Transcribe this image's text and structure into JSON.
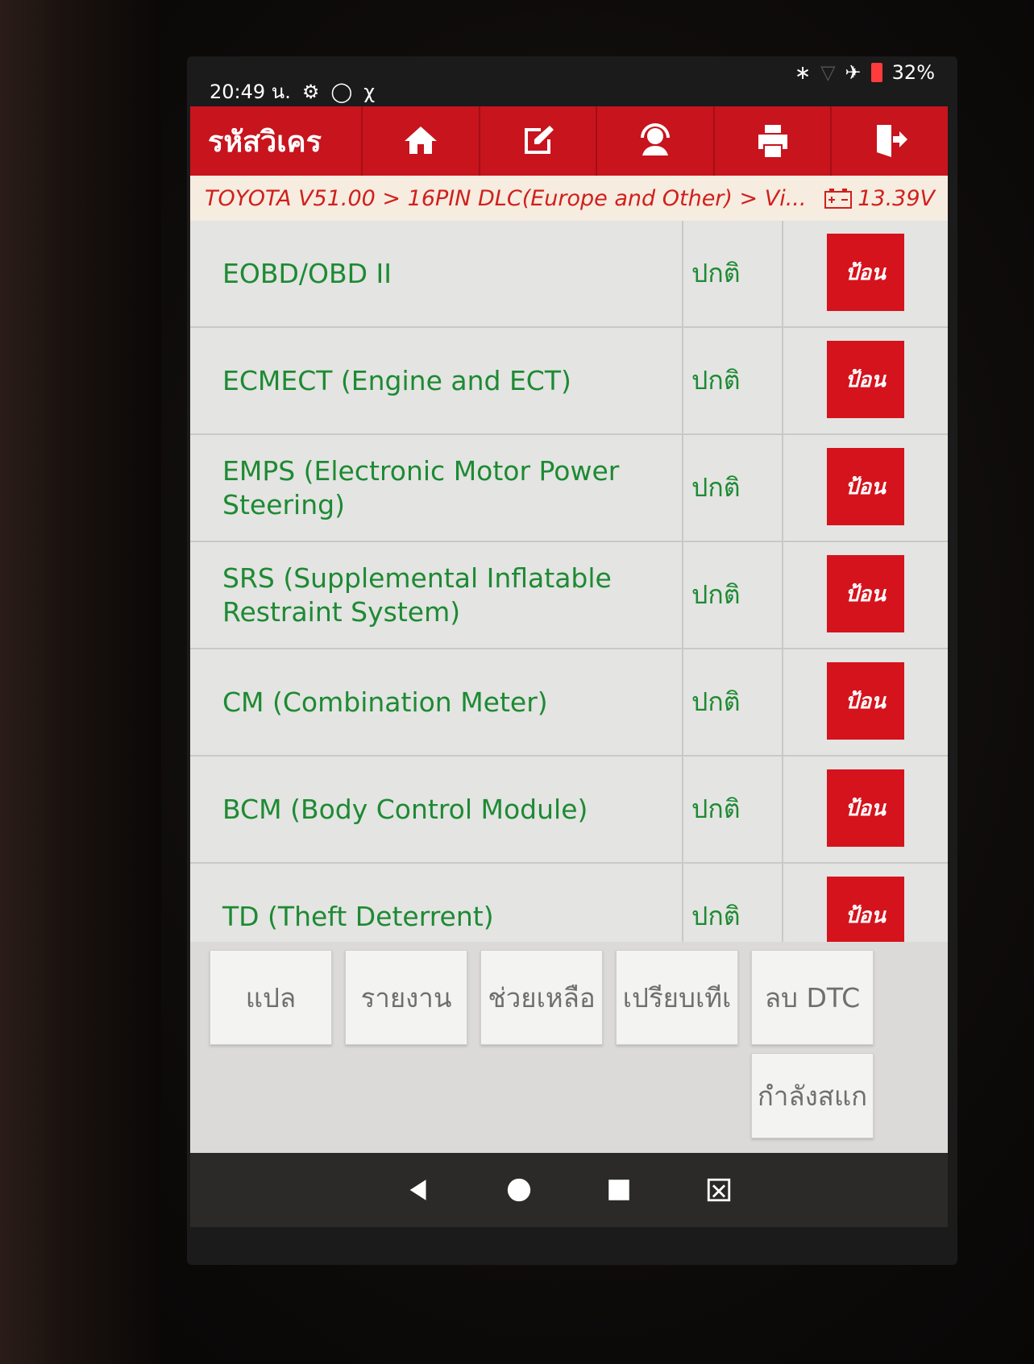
{
  "status_bar": {
    "time": "20:49 น.",
    "icons_left": [
      "gear-icon",
      "wireless-icon",
      "diagnostic-icon"
    ],
    "icons_right": [
      "bluetooth-icon",
      "wifi-icon",
      "airplane-icon",
      "battery-icon"
    ],
    "battery": "32%"
  },
  "header": {
    "title": "รหัสวิเคร",
    "buttons": [
      "home-icon",
      "edit-icon",
      "support-icon",
      "print-icon",
      "exit-icon"
    ]
  },
  "breadcrumb": {
    "path": "TOYOTA V51.00 > 16PIN DLC(Europe and Other) > Vi...",
    "voltage": "13.39V"
  },
  "systems": [
    {
      "name": "EOBD/OBD II",
      "status": "ปกติ",
      "action": "ป้อน"
    },
    {
      "name": "ECMECT (Engine and ECT)",
      "status": "ปกติ",
      "action": "ป้อน"
    },
    {
      "name": "EMPS (Electronic Motor Power Steering)",
      "status": "ปกติ",
      "action": "ป้อน"
    },
    {
      "name": "SRS (Supplemental Inflatable Restraint System)",
      "status": "ปกติ",
      "action": "ป้อน"
    },
    {
      "name": "CM (Combination Meter)",
      "status": "ปกติ",
      "action": "ป้อน"
    },
    {
      "name": "BCM (Body Control Module)",
      "status": "ปกติ",
      "action": "ป้อน"
    },
    {
      "name": "TD (Theft Deterrent)",
      "status": "ปกติ",
      "action": "ป้อน"
    }
  ],
  "bottom_buttons": {
    "translate": "แปล",
    "report": "รายงาน",
    "help": "ช่วยเหลือ",
    "compare": "เปรียบเทีเ",
    "clear_dtc": "ลบ DTC",
    "scanning": "กำลังสแก"
  },
  "colors": {
    "header_red": "#c7141d",
    "button_red": "#d5131c",
    "text_green": "#1d8a33",
    "breadcrumb_red": "#d0201c"
  }
}
